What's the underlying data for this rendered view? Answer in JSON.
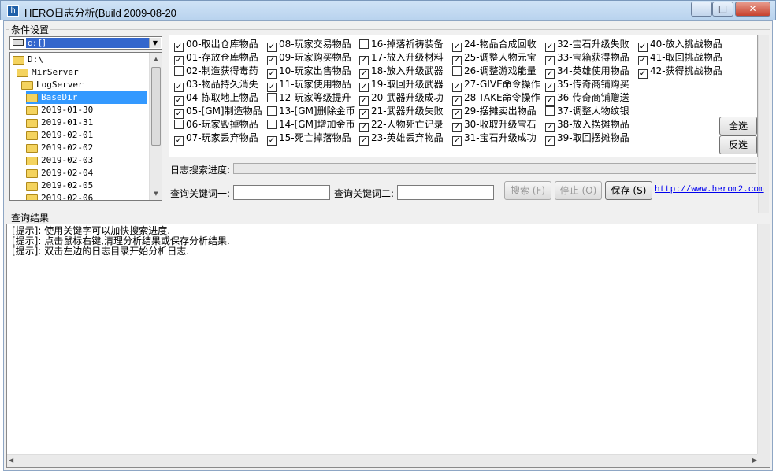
{
  "window": {
    "title": "HERO日志分析(Build 2009-08-20",
    "app_icon": "app-icon",
    "buttons": {
      "minimize": "—",
      "maximize": "□",
      "close": "✕"
    }
  },
  "conditions": {
    "group_label": "条件设置",
    "drive_value": "d: []",
    "tree": [
      {
        "label": "D:\\",
        "level": 0,
        "selected": false
      },
      {
        "label": "MirServer",
        "level": 1,
        "selected": false
      },
      {
        "label": "LogServer",
        "level": 2,
        "selected": false
      },
      {
        "label": "BaseDir",
        "level": 3,
        "selected": true
      },
      {
        "label": "2019-01-30",
        "level": 4,
        "selected": false
      },
      {
        "label": "2019-01-31",
        "level": 4,
        "selected": false
      },
      {
        "label": "2019-02-01",
        "level": 4,
        "selected": false
      },
      {
        "label": "2019-02-02",
        "level": 4,
        "selected": false
      },
      {
        "label": "2019-02-03",
        "level": 4,
        "selected": false
      },
      {
        "label": "2019-02-04",
        "level": 4,
        "selected": false
      },
      {
        "label": "2019-02-05",
        "level": 4,
        "selected": false
      },
      {
        "label": "2019-02-06",
        "level": 4,
        "selected": false
      }
    ],
    "checkbox_columns": [
      [
        {
          "label": "00-取出仓库物品",
          "checked": true
        },
        {
          "label": "01-存放仓库物品",
          "checked": true
        },
        {
          "label": "02-制造获得毒药",
          "checked": false
        },
        {
          "label": "03-物品持久消失",
          "checked": true
        },
        {
          "label": "04-拣取地上物品",
          "checked": true
        },
        {
          "label": "05-[GM]制造物品",
          "checked": true
        },
        {
          "label": "06-玩家毁掉物品",
          "checked": false
        },
        {
          "label": "07-玩家丢弃物品",
          "checked": true
        }
      ],
      [
        {
          "label": "08-玩家交易物品",
          "checked": true
        },
        {
          "label": "09-玩家购买物品",
          "checked": true
        },
        {
          "label": "10-玩家出售物品",
          "checked": true
        },
        {
          "label": "11-玩家使用物品",
          "checked": true
        },
        {
          "label": "12-玩家等级提升",
          "checked": false
        },
        {
          "label": "13-[GM]删除金币",
          "checked": false
        },
        {
          "label": "14-[GM]增加金币",
          "checked": false
        },
        {
          "label": "15-死亡掉落物品",
          "checked": true
        }
      ],
      [
        {
          "label": "16-掉落祈祷装备",
          "checked": false
        },
        {
          "label": "17-放入升级材料",
          "checked": true
        },
        {
          "label": "18-放入升级武器",
          "checked": true
        },
        {
          "label": "19-取回升级武器",
          "checked": true
        },
        {
          "label": "20-武器升级成功",
          "checked": true
        },
        {
          "label": "21-武器升级失败",
          "checked": true
        },
        {
          "label": "22-人物死亡记录",
          "checked": true
        },
        {
          "label": "23-英雄丢弃物品",
          "checked": true
        }
      ],
      [
        {
          "label": "24-物品合成回收",
          "checked": true
        },
        {
          "label": "25-调整人物元宝",
          "checked": true
        },
        {
          "label": "26-调整游戏能量",
          "checked": false
        },
        {
          "label": "27-GIVE命令操作",
          "checked": true
        },
        {
          "label": "28-TAKE命令操作",
          "checked": true
        },
        {
          "label": "29-摆摊卖出物品",
          "checked": true
        },
        {
          "label": "30-收取升级宝石",
          "checked": true
        },
        {
          "label": "31-宝石升级成功",
          "checked": true
        }
      ],
      [
        {
          "label": "32-宝石升级失败",
          "checked": true
        },
        {
          "label": "33-宝箱获得物品",
          "checked": true
        },
        {
          "label": "34-英雄使用物品",
          "checked": true
        },
        {
          "label": "35-传奇商铺购买",
          "checked": true
        },
        {
          "label": "36-传奇商铺赠送",
          "checked": true
        },
        {
          "label": "37-调整人物纹银",
          "checked": false
        },
        {
          "label": "38-放入摆摊物品",
          "checked": true
        },
        {
          "label": "39-取回摆摊物品",
          "checked": true
        }
      ],
      [
        {
          "label": "40-放入挑战物品",
          "checked": true
        },
        {
          "label": "41-取回挑战物品",
          "checked": true
        },
        {
          "label": "42-获得挑战物品",
          "checked": true
        }
      ]
    ],
    "select_all": "全选",
    "invert": "反选",
    "progress_label": "日志搜索进度:",
    "progress": 0,
    "keyword1_label": "查询关键词一:",
    "keyword1_value": "",
    "keyword2_label": "查询关键词二:",
    "keyword2_value": "",
    "search_btn": "搜索 (F)",
    "stop_btn": "停止 (O)",
    "save_btn": "保存 (S)",
    "link": "http://www.herom2.com"
  },
  "results": {
    "group_label": "查询结果",
    "lines": [
      "[提示]: 使用关键字可以加快搜索进度.",
      "[提示]: 点击鼠标右键,清理分析结果或保存分析结果.",
      "[提示]: 双击左边的日志目录开始分析日志."
    ]
  }
}
